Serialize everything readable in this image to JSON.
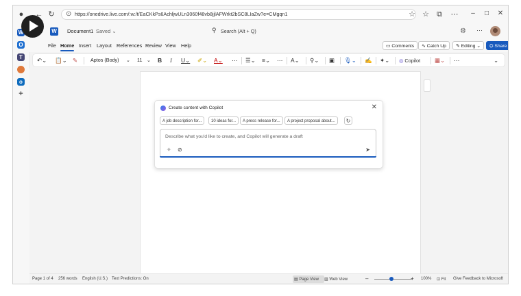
{
  "browser": {
    "url": "https://onedrive.live.com/:w:/t/EaCKkPs6AchljwULn3060f48vb8jjlAFWrkt2bSC8LIaZw?e=CMgqn1"
  },
  "word": {
    "doc_title": "Document1",
    "saved_status": "Saved",
    "search_placeholder": "Search (Alt + Q)"
  },
  "menu": {
    "tabs": [
      "File",
      "Home",
      "Insert",
      "Layout",
      "References",
      "Review",
      "View",
      "Help"
    ],
    "comments": "Comments",
    "catchup": "Catch Up",
    "editing": "Editing",
    "share": "Share"
  },
  "ribbon": {
    "font_name": "Aptos (Body)",
    "font_size": "11",
    "copilot": "Copilot"
  },
  "copilot_dialog": {
    "title": "Create content with Copilot",
    "chips": [
      "A job description for...",
      "10 ideas for...",
      "A press release for...",
      "A project proposal about..."
    ],
    "placeholder": "Describe what you'd like to create, and Copilot will generate a draft"
  },
  "status": {
    "page": "Page 1 of 4",
    "words": "256 words",
    "language": "English (U.S.)",
    "predictions": "Text Predictions: On",
    "page_view": "Page View",
    "web_view": "Web View",
    "zoom": "100%",
    "fit": "Fit",
    "feedback": "Give Feedback to Microsoft"
  },
  "colors": {
    "accent": "#185abd",
    "share_bg": "#185abd"
  }
}
